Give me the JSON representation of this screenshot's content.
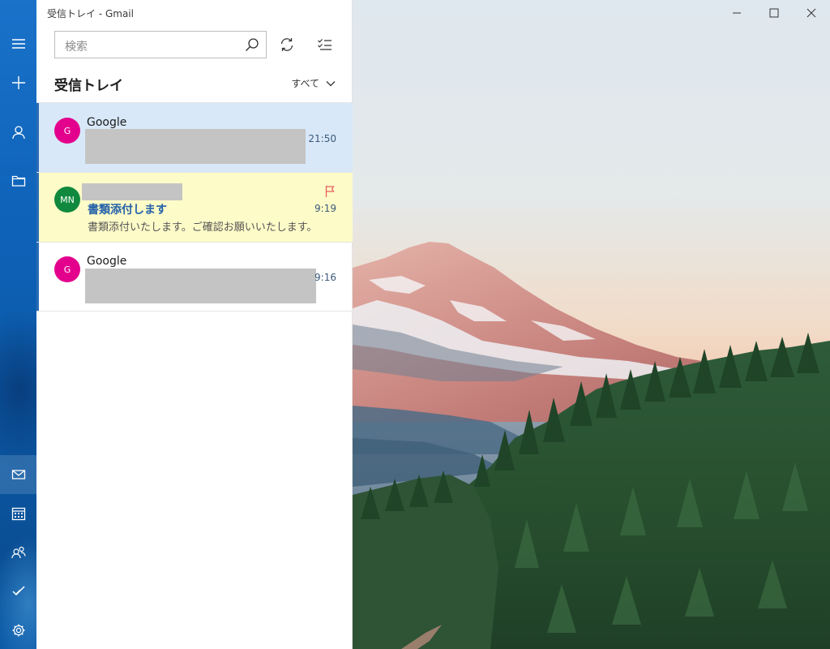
{
  "window": {
    "title": "受信トレイ - Gmail"
  },
  "nav": {
    "items": [
      {
        "icon": "hamburger-icon"
      },
      {
        "icon": "plus-icon"
      },
      {
        "icon": "person-icon"
      },
      {
        "icon": "folder-icon"
      }
    ],
    "bottom": [
      {
        "icon": "mail-icon",
        "active": true
      },
      {
        "icon": "calendar-icon"
      },
      {
        "icon": "people-icon"
      },
      {
        "icon": "todo-icon"
      },
      {
        "icon": "gear-icon"
      }
    ]
  },
  "search": {
    "placeholder": "検索"
  },
  "folder": {
    "title": "受信トレイ",
    "filter_label": "すべて"
  },
  "messages": [
    {
      "initials": "G",
      "avatar_color": "#e3008c",
      "sender": "Google",
      "time": "21:50",
      "state": "selected"
    },
    {
      "initials": "MN",
      "avatar_color": "#10893e",
      "sender": "",
      "subject": "書類添付します",
      "preview": "書類添付いたします。ご確認お願いいたします。",
      "time": "9:19",
      "flagged": true,
      "flag_color": "#e85d5d"
    },
    {
      "initials": "G",
      "avatar_color": "#e3008c",
      "sender": "Google",
      "time": "9:16"
    }
  ],
  "colors": {
    "rail": "#0e62b8",
    "selected_row": "#d8e8f8",
    "flagged_row": "#fdfbc8",
    "accent": "#2b6cb4",
    "subject": "#2361a8"
  }
}
